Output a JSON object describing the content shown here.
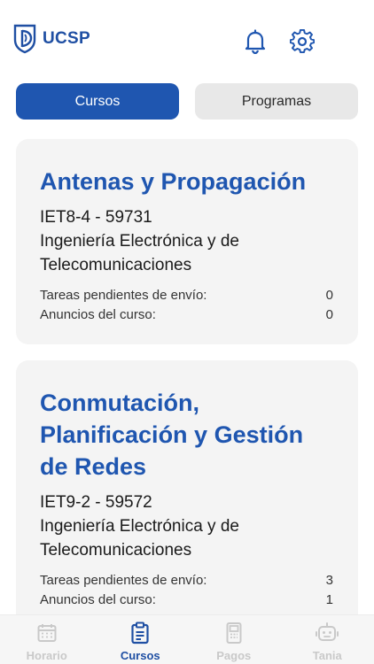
{
  "brand": {
    "name": "UCSP"
  },
  "header": {
    "icons": [
      "bell-icon",
      "gear-icon"
    ]
  },
  "tabs": [
    {
      "label": "Cursos",
      "active": true
    },
    {
      "label": "Programas",
      "active": false
    }
  ],
  "courses": [
    {
      "title": "Antenas y Propagación",
      "code": "IET8-4 - 59731",
      "school": "Ingeniería Electrónica y  de Telecomunicaciones",
      "pending_label": "Tareas pendientes de envío:",
      "pending_count": "0",
      "announcements_label": "Anuncios del curso:",
      "announcements_count": "0"
    },
    {
      "title": "Conmutación, Planificación y Gestión de Redes",
      "code": "IET9-2 - 59572",
      "school": "Ingeniería Electrónica y  de Telecomunicaciones",
      "pending_label": "Tareas pendientes de envío:",
      "pending_count": "3",
      "announcements_label": "Anuncios del curso:",
      "announcements_count": "1"
    }
  ],
  "bottom_nav": [
    {
      "label": "Horario",
      "icon": "calendar-icon",
      "active": false
    },
    {
      "label": "Cursos",
      "icon": "clipboard-icon",
      "active": true
    },
    {
      "label": "Pagos",
      "icon": "payment-terminal-icon",
      "active": false
    },
    {
      "label": "Tania",
      "icon": "robot-icon",
      "active": false
    }
  ],
  "colors": {
    "primary": "#1f56b0",
    "inactive_tab": "#e8e8e8",
    "card_bg": "#f4f4f4",
    "muted": "#c9c9c9"
  }
}
